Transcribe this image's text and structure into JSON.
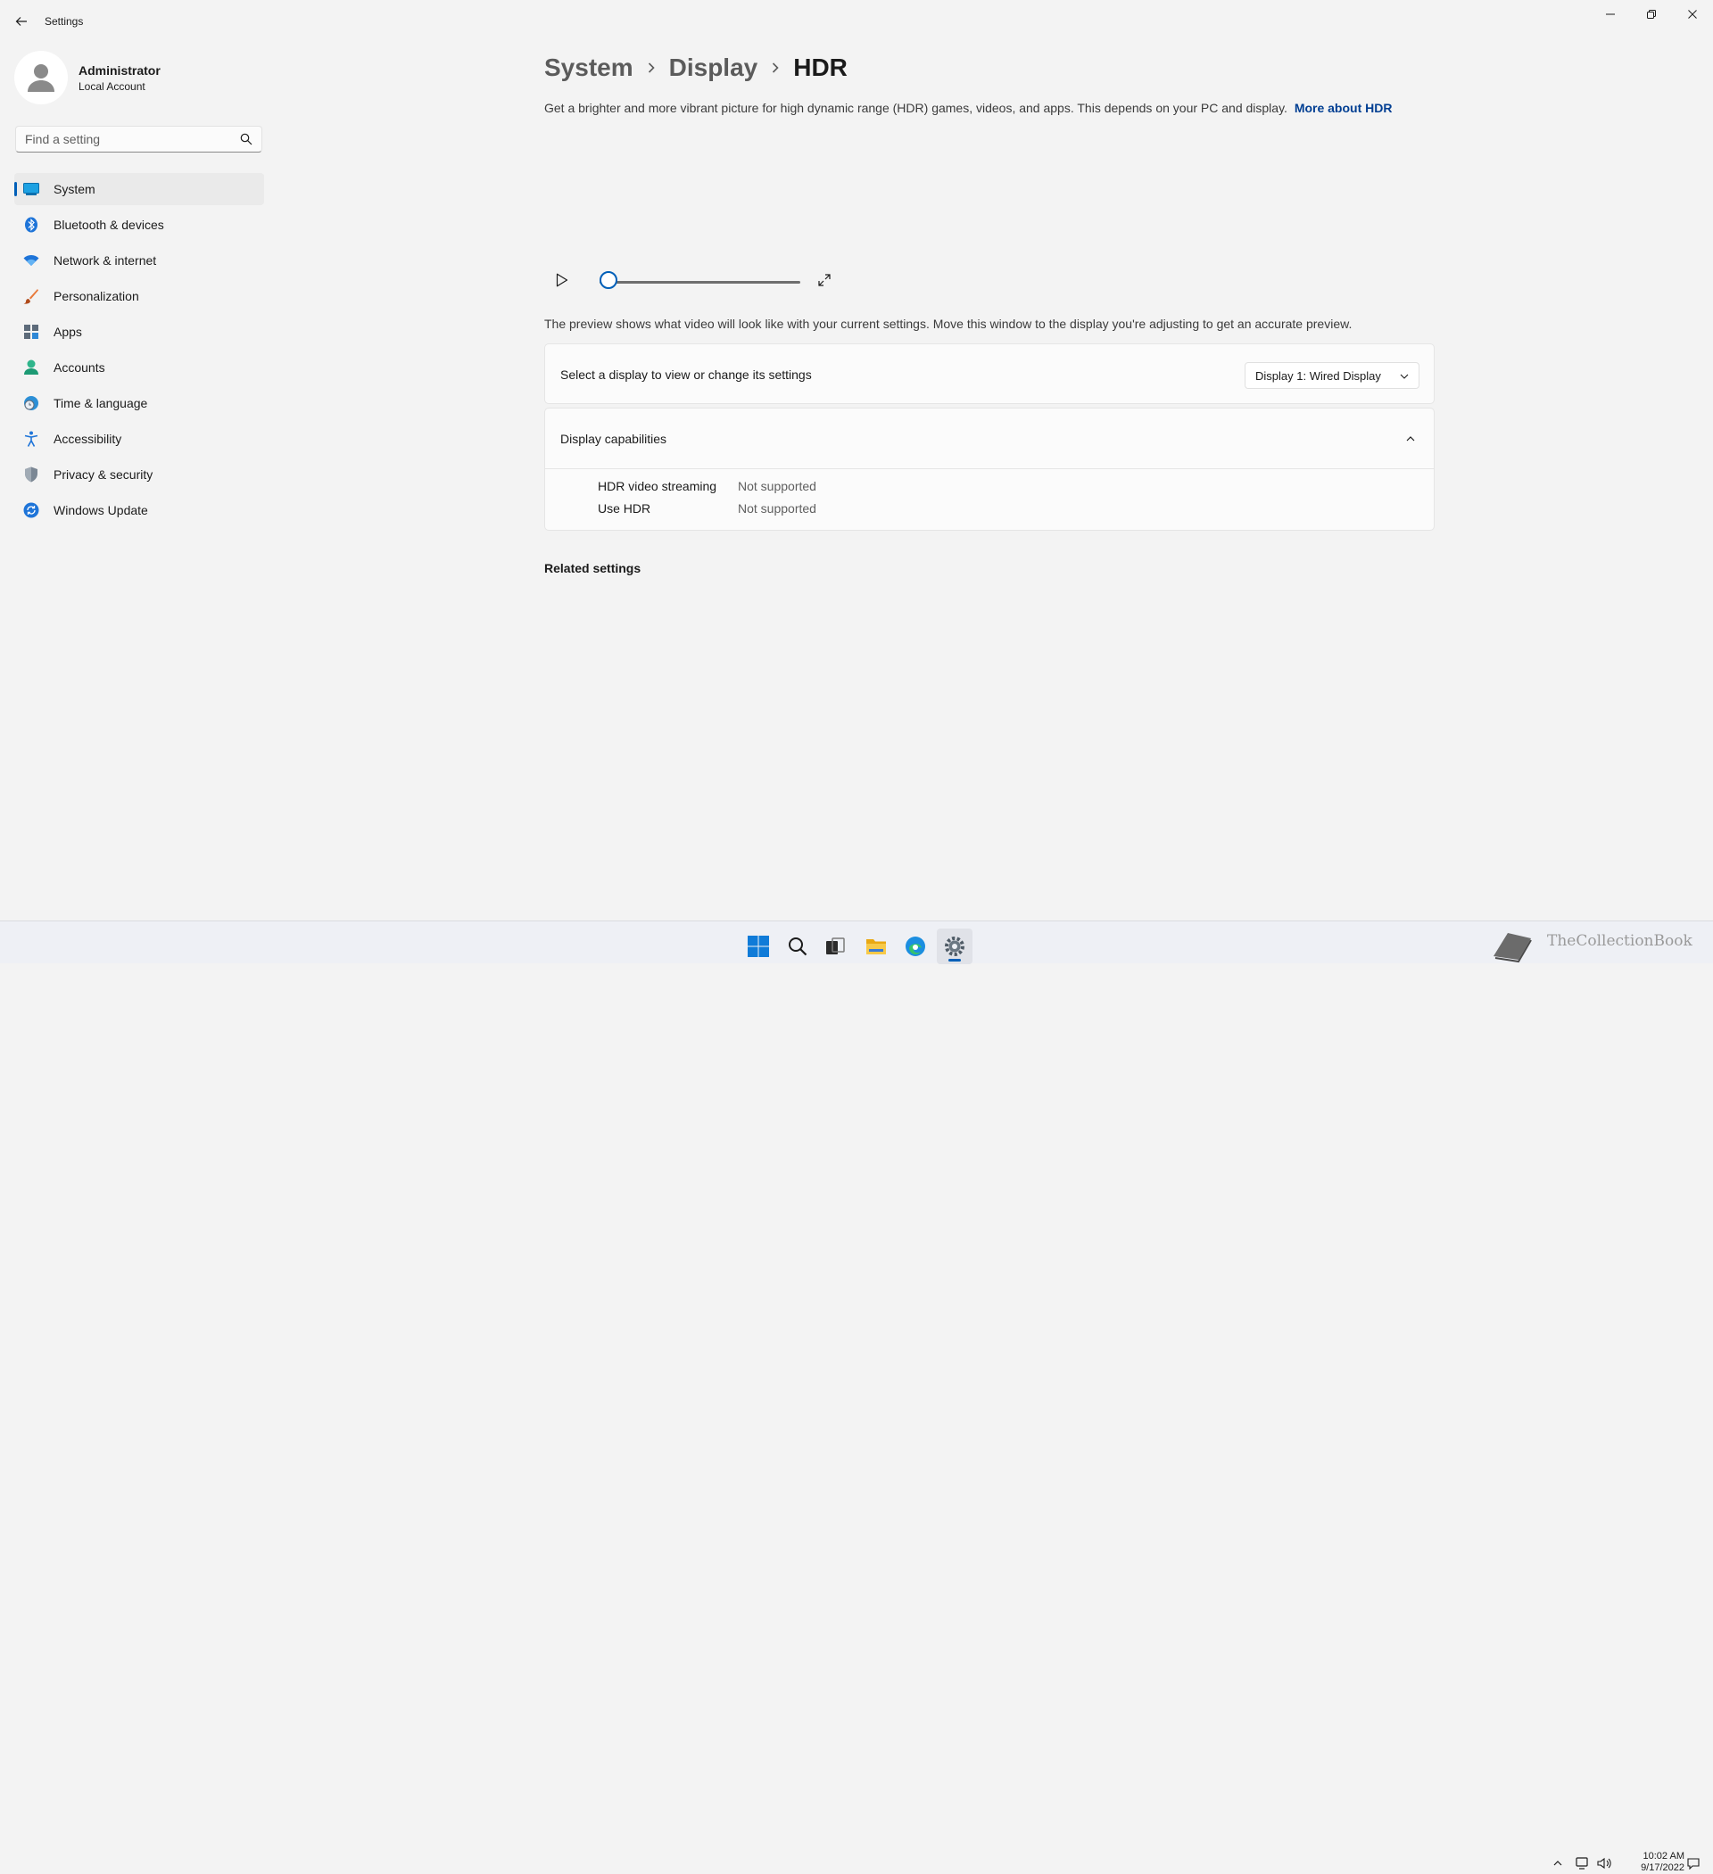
{
  "window": {
    "title": "Settings"
  },
  "profile": {
    "name": "Administrator",
    "account_type": "Local Account"
  },
  "search": {
    "placeholder": "Find a setting"
  },
  "sidebar": {
    "items": [
      {
        "label": "System",
        "icon": "system-icon",
        "active": true
      },
      {
        "label": "Bluetooth & devices",
        "icon": "bluetooth-icon"
      },
      {
        "label": "Network & internet",
        "icon": "wifi-icon"
      },
      {
        "label": "Personalization",
        "icon": "brush-icon"
      },
      {
        "label": "Apps",
        "icon": "apps-icon"
      },
      {
        "label": "Accounts",
        "icon": "accounts-icon"
      },
      {
        "label": "Time & language",
        "icon": "globe-clock-icon"
      },
      {
        "label": "Accessibility",
        "icon": "accessibility-icon"
      },
      {
        "label": "Privacy & security",
        "icon": "shield-icon"
      },
      {
        "label": "Windows Update",
        "icon": "update-icon"
      }
    ]
  },
  "breadcrumb": {
    "items": [
      "System",
      "Display",
      "HDR"
    ]
  },
  "main": {
    "description": "Get a brighter and more vibrant picture for high dynamic range (HDR) games, videos, and apps. This depends on your PC and display.",
    "more_link": "More about HDR",
    "video_progress": 0,
    "preview_note": "The preview shows what video will look like with your current settings. Move this window to the display you're adjusting to get an accurate preview.",
    "display_select": {
      "label": "Select a display to view or change its settings",
      "value": "Display 1: Wired Display"
    },
    "capabilities": {
      "title": "Display capabilities",
      "rows": [
        {
          "name": "HDR video streaming",
          "value": "Not supported"
        },
        {
          "name": "Use HDR",
          "value": "Not supported"
        }
      ]
    },
    "related_heading": "Related settings"
  },
  "taskbar": {
    "apps": [
      "start-icon",
      "search-icon",
      "task-view-icon",
      "file-explorer-icon",
      "edge-icon",
      "settings-icon"
    ],
    "watermark": "TheCollectionBook",
    "time": "10:02 AM",
    "date": "9/17/2022"
  },
  "colors": {
    "accent": "#005fb8",
    "link": "#003e92",
    "background": "#f3f3f3",
    "card": "#fbfbfb"
  }
}
